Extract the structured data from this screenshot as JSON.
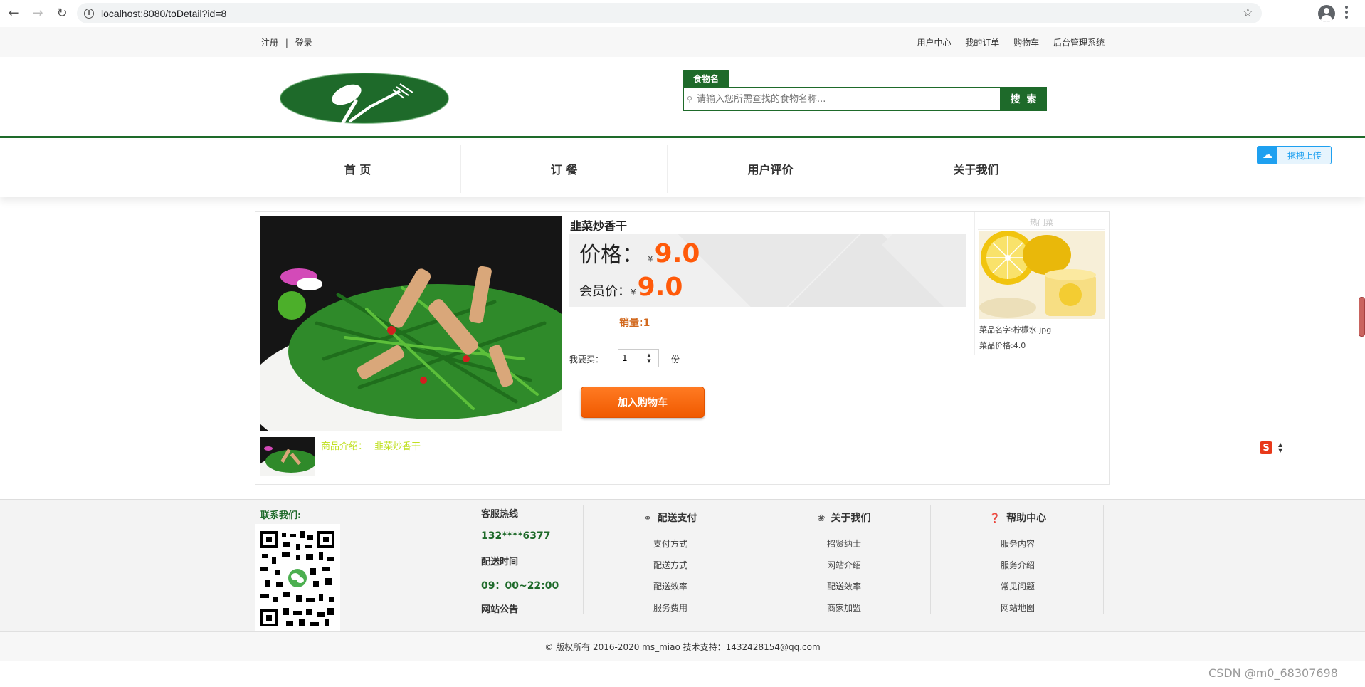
{
  "browser": {
    "url": "localhost:8080/toDetail?id=8"
  },
  "topbar": {
    "register": "注册",
    "separator": "|",
    "login": "登录",
    "links": [
      "用户中心",
      "我的订单",
      "购物车",
      "后台管理系统"
    ]
  },
  "search": {
    "tab": "食物名",
    "placeholder": "请输入您所需查找的食物名称...",
    "button": "搜 索"
  },
  "nav": {
    "items": [
      "首 页",
      "订 餐",
      "用户评价",
      "关于我们"
    ]
  },
  "upload_badge": "拖拽上传",
  "product": {
    "title": "韭菜炒香干",
    "price_label": "价格：",
    "currency": "¥",
    "price": "9.0",
    "member_label": "会员价：",
    "member_price": "9.0",
    "sales": "销量:1",
    "qty_label": "我要买：",
    "qty_value": "1",
    "qty_unit": "份",
    "cart_button": "加入购物车",
    "intro_label": "商品介绍：",
    "intro_text": "韭菜炒香干"
  },
  "hot": {
    "header": "热门菜",
    "name": "菜品名字:柠檬水.jpg",
    "price": "菜品价格:4.0"
  },
  "footer": {
    "contact": "联系我们:",
    "hotline_title": "客服热线",
    "hotline": "132****6377",
    "delivery_time_title": "配送时间",
    "delivery_time": "09：00~22:00",
    "notice": "网站公告",
    "columns": [
      {
        "title": "配送支付",
        "icon": "bike-icon",
        "links": [
          "支付方式",
          "配送方式",
          "配送效率",
          "服务费用"
        ]
      },
      {
        "title": "关于我们",
        "icon": "leaf-icon",
        "links": [
          "招贤纳士",
          "网站介绍",
          "配送效率",
          "商家加盟"
        ]
      },
      {
        "title": "帮助中心",
        "icon": "question-icon",
        "links": [
          "服务内容",
          "服务介绍",
          "常见问题",
          "网站地图"
        ]
      }
    ],
    "copyright": "© 版权所有 2016-2020   ms_miao 技术支持：1432428154@qq.com"
  },
  "watermark": "CSDN @m0_68307698",
  "colors": {
    "brand_green": "#1e6a2a",
    "price_orange": "#ff5a0a",
    "button_orange": "#f05a00"
  }
}
